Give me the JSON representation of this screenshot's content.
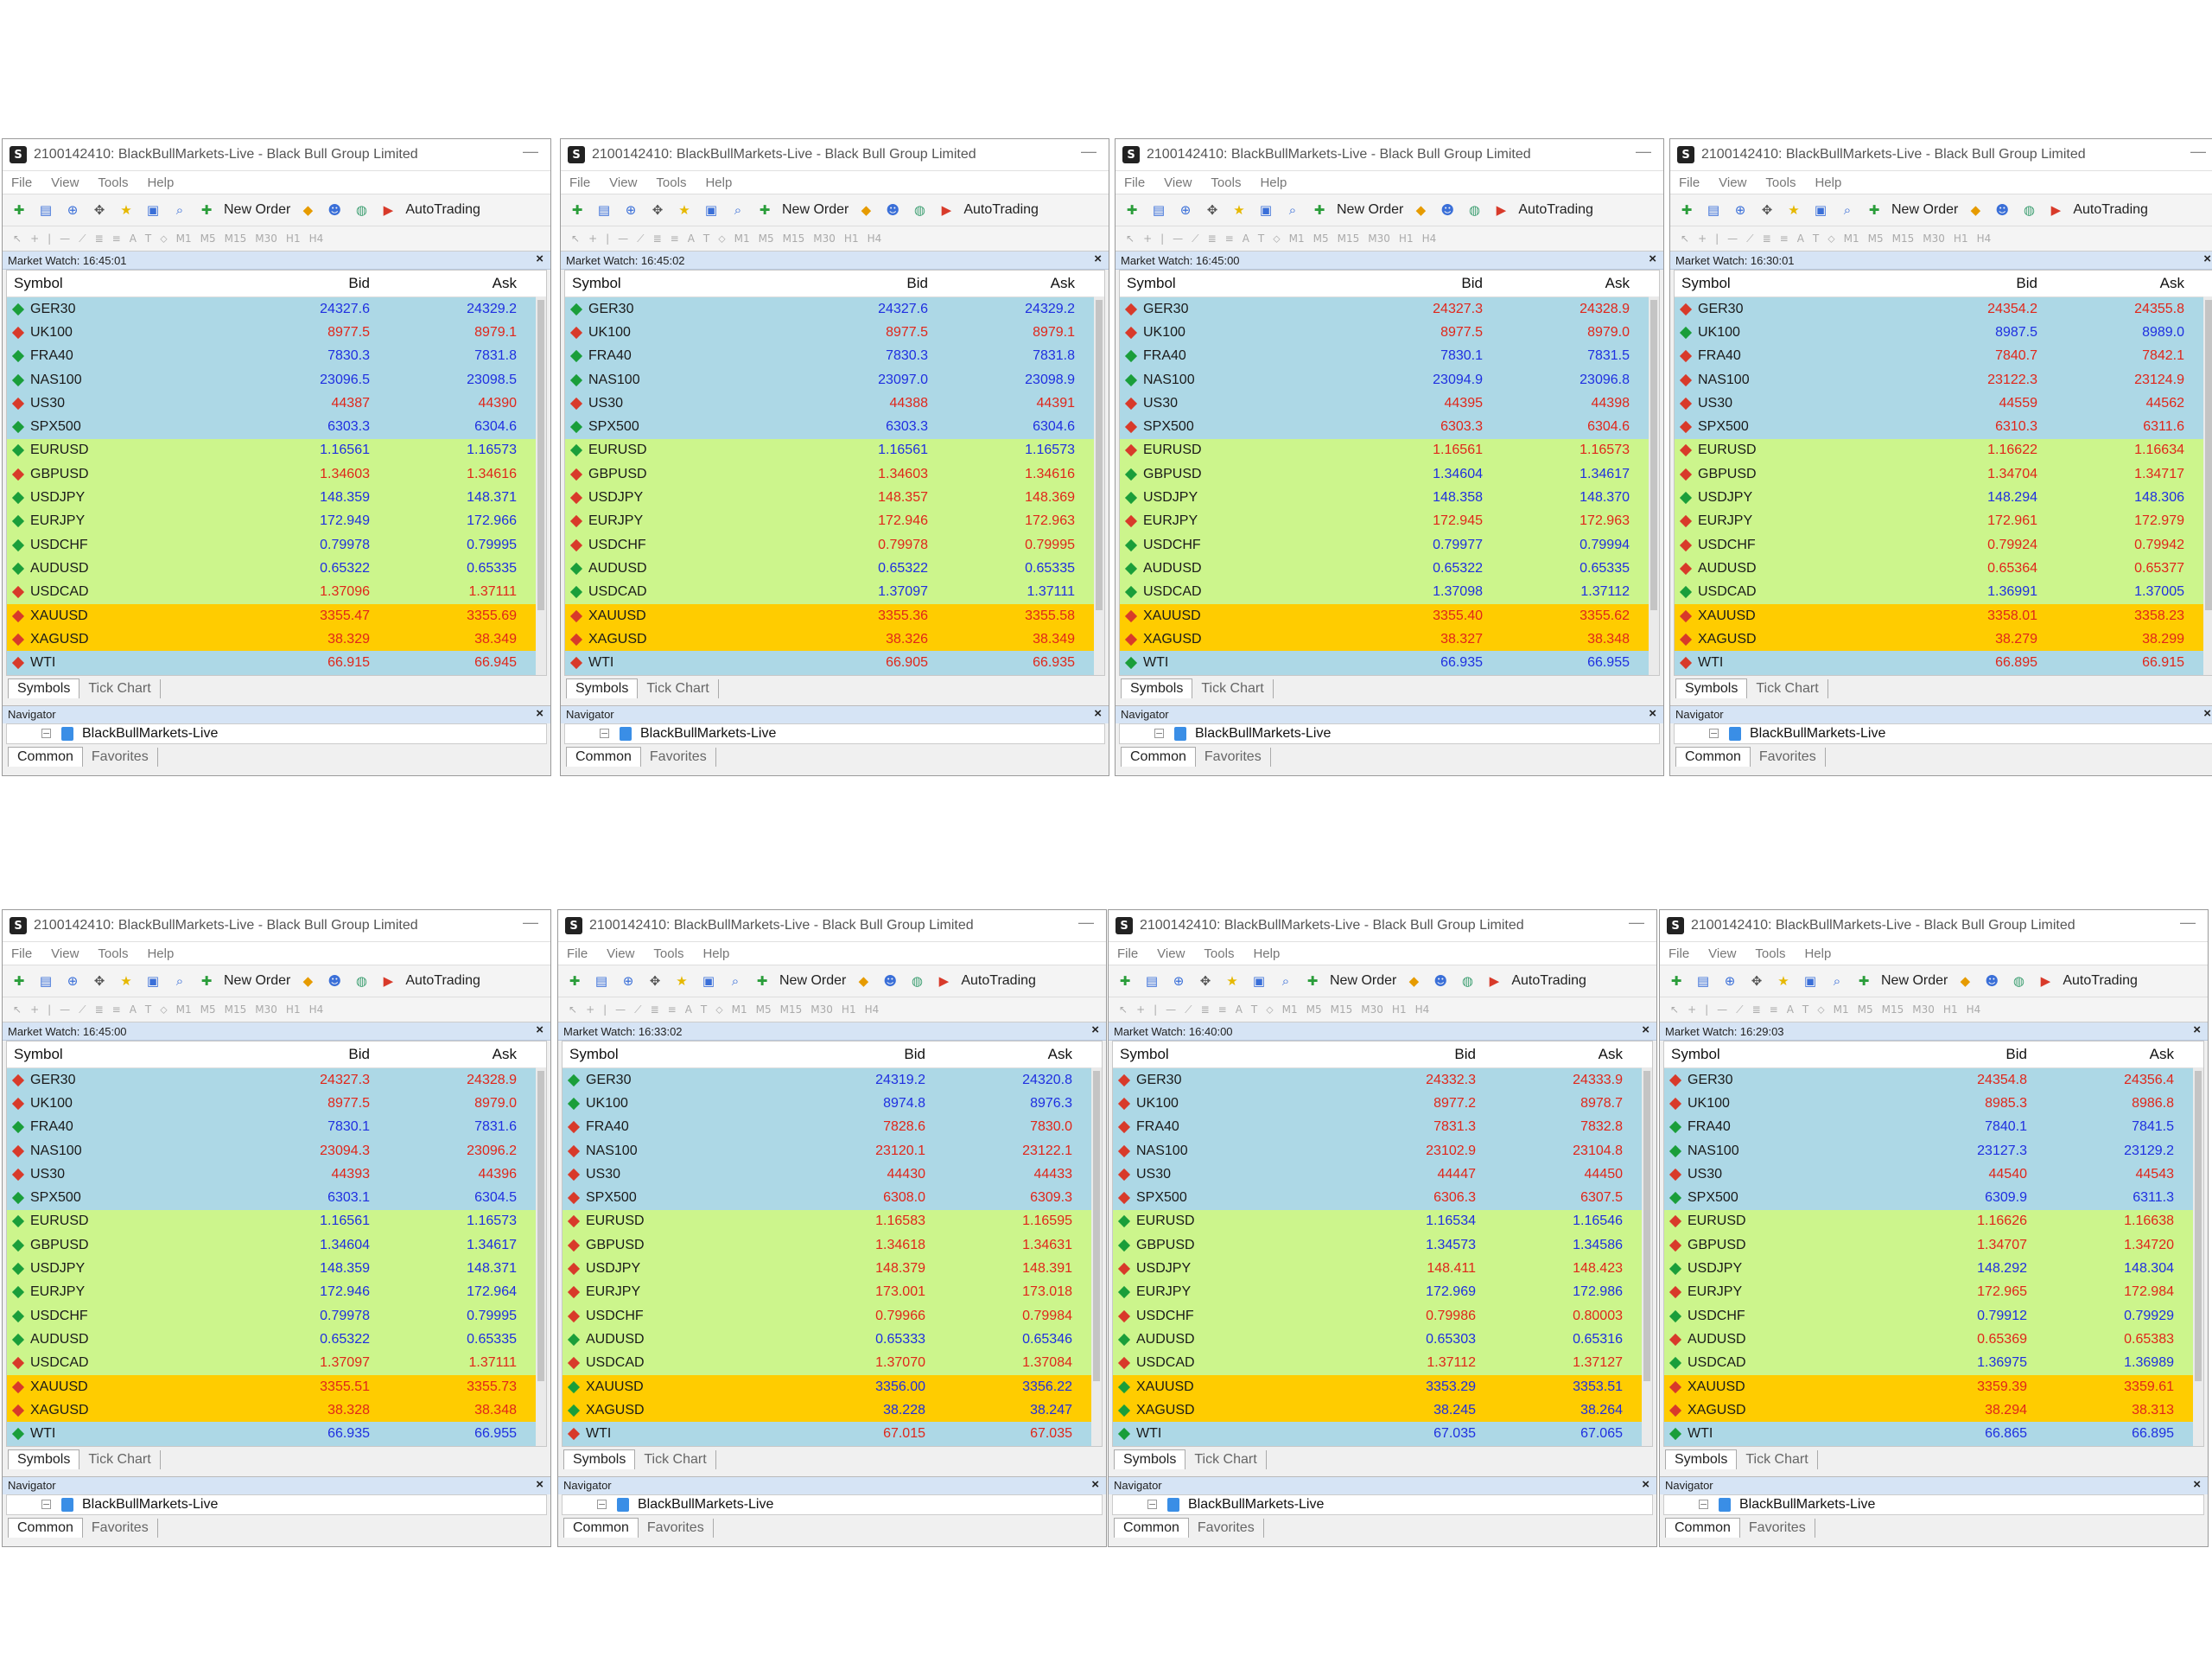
{
  "app": {
    "title": "2100142410: BlackBullMarkets-Live - Black Bull Group Limited",
    "menu": [
      "File",
      "View",
      "Tools",
      "Help"
    ],
    "toolbar": {
      "new_order": "New Order",
      "autotrading": "AutoTrading"
    },
    "timeframes": [
      "M1",
      "M5",
      "M15",
      "M30",
      "H1",
      "H4"
    ],
    "columns": {
      "symbol": "Symbol",
      "bid": "Bid",
      "ask": "Ask"
    },
    "tabs": [
      "Symbols",
      "Tick Chart"
    ],
    "navigator": {
      "title": "Navigator",
      "root": "BlackBullMarkets-Live",
      "tabs": [
        "Common",
        "Favorites"
      ]
    },
    "symbols": [
      "GER30",
      "UK100",
      "FRA40",
      "NAS100",
      "US30",
      "SPX500",
      "EURUSD",
      "GBPUSD",
      "USDJPY",
      "EURJPY",
      "USDCHF",
      "AUDUSD",
      "USDCAD",
      "XAUUSD",
      "XAGUSD",
      "WTI"
    ],
    "groups": [
      "blue",
      "blue",
      "blue",
      "blue",
      "blue",
      "blue",
      "green",
      "green",
      "green",
      "green",
      "green",
      "green",
      "green",
      "gold",
      "gold",
      "blue"
    ],
    "colors": {
      "blue_row": "#add8e6",
      "green_row": "#ccf58c",
      "gold_row": "#ffcc00",
      "price_up": "#1f2fe0",
      "price_down": "#e0261a"
    }
  },
  "panels": [
    {
      "header": "Market Watch: 16:45:01",
      "bid": [
        "24327.6",
        "8977.5",
        "7830.3",
        "23096.5",
        "44387",
        "6303.3",
        "1.16561",
        "1.34603",
        "148.359",
        "172.949",
        "0.79978",
        "0.65322",
        "1.37096",
        "3355.47",
        "38.329",
        "66.915"
      ],
      "ask": [
        "24329.2",
        "8979.1",
        "7831.8",
        "23098.5",
        "44390",
        "6304.6",
        "1.16573",
        "1.34616",
        "148.371",
        "172.966",
        "0.79995",
        "0.65335",
        "1.37111",
        "3355.69",
        "38.349",
        "66.945"
      ],
      "dir": [
        "u",
        "d",
        "u",
        "u",
        "d",
        "u",
        "u",
        "d",
        "u",
        "u",
        "u",
        "u",
        "d",
        "d",
        "d",
        "d"
      ]
    },
    {
      "header": "Market Watch: 16:45:02",
      "bid": [
        "24327.6",
        "8977.5",
        "7830.3",
        "23097.0",
        "44388",
        "6303.3",
        "1.16561",
        "1.34603",
        "148.357",
        "172.946",
        "0.79978",
        "0.65322",
        "1.37097",
        "3355.36",
        "38.326",
        "66.905"
      ],
      "ask": [
        "24329.2",
        "8979.1",
        "7831.8",
        "23098.9",
        "44391",
        "6304.6",
        "1.16573",
        "1.34616",
        "148.369",
        "172.963",
        "0.79995",
        "0.65335",
        "1.37111",
        "3355.58",
        "38.349",
        "66.935"
      ],
      "dir": [
        "u",
        "d",
        "u",
        "u",
        "d",
        "u",
        "u",
        "d",
        "d",
        "d",
        "d",
        "u",
        "u",
        "d",
        "d",
        "d"
      ]
    },
    {
      "header": "Market Watch: 16:45:00",
      "bid": [
        "24327.3",
        "8977.5",
        "7830.1",
        "23094.9",
        "44395",
        "6303.3",
        "1.16561",
        "1.34604",
        "148.358",
        "172.945",
        "0.79977",
        "0.65322",
        "1.37098",
        "3355.40",
        "38.327",
        "66.935"
      ],
      "ask": [
        "24328.9",
        "8979.0",
        "7831.5",
        "23096.8",
        "44398",
        "6304.6",
        "1.16573",
        "1.34617",
        "148.370",
        "172.963",
        "0.79994",
        "0.65335",
        "1.37112",
        "3355.62",
        "38.348",
        "66.955"
      ],
      "dir": [
        "d",
        "d",
        "u",
        "u",
        "d",
        "d",
        "d",
        "u",
        "u",
        "d",
        "u",
        "u",
        "u",
        "d",
        "d",
        "u"
      ]
    },
    {
      "header": "Market Watch: 16:30:01",
      "bid": [
        "24354.2",
        "8987.5",
        "7840.7",
        "23122.3",
        "44559",
        "6310.3",
        "1.16622",
        "1.34704",
        "148.294",
        "172.961",
        "0.79924",
        "0.65364",
        "1.36991",
        "3358.01",
        "38.279",
        "66.895"
      ],
      "ask": [
        "24355.8",
        "8989.0",
        "7842.1",
        "23124.9",
        "44562",
        "6311.6",
        "1.16634",
        "1.34717",
        "148.306",
        "172.979",
        "0.79942",
        "0.65377",
        "1.37005",
        "3358.23",
        "38.299",
        "66.915"
      ],
      "dir": [
        "d",
        "u",
        "d",
        "d",
        "d",
        "d",
        "d",
        "d",
        "u",
        "d",
        "d",
        "d",
        "u",
        "d",
        "d",
        "d"
      ]
    },
    {
      "header": "Market Watch: 16:45:00",
      "bid": [
        "24327.3",
        "8977.5",
        "7830.1",
        "23094.3",
        "44393",
        "6303.1",
        "1.16561",
        "1.34604",
        "148.359",
        "172.946",
        "0.79978",
        "0.65322",
        "1.37097",
        "3355.51",
        "38.328",
        "66.935"
      ],
      "ask": [
        "24328.9",
        "8979.0",
        "7831.6",
        "23096.2",
        "44396",
        "6304.5",
        "1.16573",
        "1.34617",
        "148.371",
        "172.964",
        "0.79995",
        "0.65335",
        "1.37111",
        "3355.73",
        "38.348",
        "66.955"
      ],
      "dir": [
        "d",
        "d",
        "u",
        "d",
        "d",
        "u",
        "u",
        "u",
        "u",
        "u",
        "u",
        "u",
        "d",
        "d",
        "d",
        "u"
      ]
    },
    {
      "header": "Market Watch: 16:33:02",
      "bid": [
        "24319.2",
        "8974.8",
        "7828.6",
        "23120.1",
        "44430",
        "6308.0",
        "1.16583",
        "1.34618",
        "148.379",
        "173.001",
        "0.79966",
        "0.65333",
        "1.37070",
        "3356.00",
        "38.228",
        "67.015"
      ],
      "ask": [
        "24320.8",
        "8976.3",
        "7830.0",
        "23122.1",
        "44433",
        "6309.3",
        "1.16595",
        "1.34631",
        "148.391",
        "173.018",
        "0.79984",
        "0.65346",
        "1.37084",
        "3356.22",
        "38.247",
        "67.035"
      ],
      "dir": [
        "u",
        "u",
        "d",
        "d",
        "d",
        "d",
        "d",
        "d",
        "d",
        "d",
        "d",
        "u",
        "d",
        "u",
        "u",
        "d"
      ]
    },
    {
      "header": "Market Watch: 16:40:00",
      "bid": [
        "24332.3",
        "8977.2",
        "7831.3",
        "23102.9",
        "44447",
        "6306.3",
        "1.16534",
        "1.34573",
        "148.411",
        "172.969",
        "0.79986",
        "0.65303",
        "1.37112",
        "3353.29",
        "38.245",
        "67.035"
      ],
      "ask": [
        "24333.9",
        "8978.7",
        "7832.8",
        "23104.8",
        "44450",
        "6307.5",
        "1.16546",
        "1.34586",
        "148.423",
        "172.986",
        "0.80003",
        "0.65316",
        "1.37127",
        "3353.51",
        "38.264",
        "67.065"
      ],
      "dir": [
        "d",
        "d",
        "d",
        "d",
        "d",
        "d",
        "u",
        "u",
        "d",
        "u",
        "d",
        "u",
        "d",
        "u",
        "u",
        "u"
      ]
    },
    {
      "header": "Market Watch: 16:29:03",
      "bid": [
        "24354.8",
        "8985.3",
        "7840.1",
        "23127.3",
        "44540",
        "6309.9",
        "1.16626",
        "1.34707",
        "148.292",
        "172.965",
        "0.79912",
        "0.65369",
        "1.36975",
        "3359.39",
        "38.294",
        "66.865"
      ],
      "ask": [
        "24356.4",
        "8986.8",
        "7841.5",
        "23129.2",
        "44543",
        "6311.3",
        "1.16638",
        "1.34720",
        "148.304",
        "172.984",
        "0.79929",
        "0.65383",
        "1.36989",
        "3359.61",
        "38.313",
        "66.895"
      ],
      "dir": [
        "d",
        "d",
        "u",
        "u",
        "d",
        "u",
        "d",
        "d",
        "u",
        "d",
        "u",
        "d",
        "u",
        "d",
        "d",
        "u"
      ]
    }
  ]
}
